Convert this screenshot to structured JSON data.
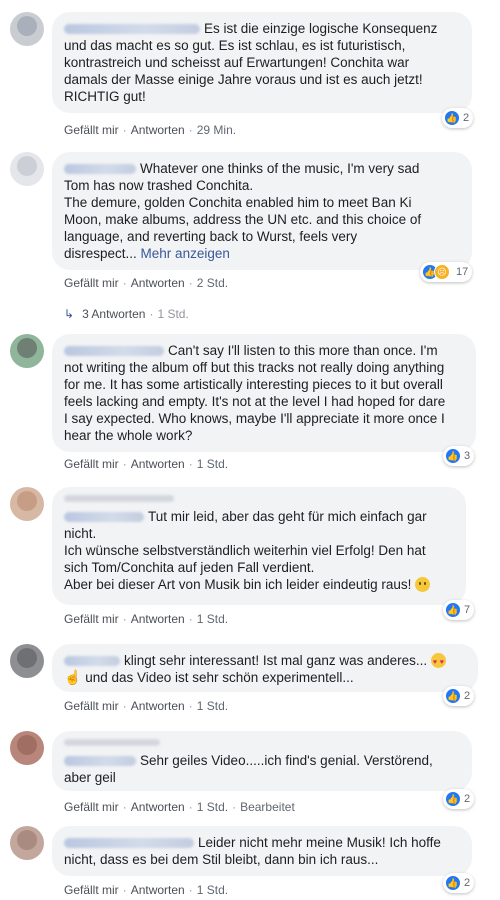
{
  "labels": {
    "like": "Gefällt mir",
    "reply": "Antworten",
    "edited": "Bearbeitet",
    "see_more": "Mehr anzeigen",
    "separator": "·"
  },
  "comments": [
    {
      "text": "Es ist die einzige logische Konsequenz\nund das macht es so gut. Es ist schlau, es ist futuristisch,\nkontrastreich und scheisst auf Erwartungen! Conchita war\ndamals der Masse einige Jahre voraus und ist es auch jetzt!\nRICHTIG gut!",
      "time": "29 Min.",
      "reaction_count": "2"
    },
    {
      "text": "Whatever one thinks of the music, I'm very sad\nTom has now trashed Conchita.\nThe demure, golden Conchita enabled him to meet Ban Ki\nMoon, make albums, address the UN etc. and this choice of\nlanguage, and reverting back to Wurst, feels very\ndisrespect...",
      "time": "2 Std.",
      "reaction_count": "17",
      "replies_label": "3 Antworten",
      "replies_time": "1 Std."
    },
    {
      "text": "Can't say I'll listen to this more than once. I'm\nnot writing the album off but this tracks not really doing anything\nfor me. It has some artistically interesting pieces to it but overall\nfeels lacking and empty. It's not at the level I had hoped for dare\nI say expected. Who knows, maybe I'll appreciate it more once I\nhear the whole work?",
      "time": "1 Std.",
      "reaction_count": "3"
    },
    {
      "text": "Tut mir leid, aber das geht für mich einfach gar\nnicht.\nIch wünsche selbstverständlich weiterhin viel Erfolg! Den hat\nsich Tom/Conchita auf jeden Fall verdient.\nAber bei dieser Art von Musik bin ich leider eindeutig raus!",
      "time": "1 Std.",
      "reaction_count": "7"
    },
    {
      "text": "klingt sehr interessant! Ist mal ganz was anderes...",
      "text2": "und das Video ist sehr schön experimentell...",
      "time": "1 Std.",
      "reaction_count": "2"
    },
    {
      "text": "Sehr geiles Video.....ich find's genial. Verstörend,\naber geil",
      "time": "1 Std.",
      "reaction_count": "2"
    },
    {
      "text": "Leider nicht mehr meine Musik! Ich hoffe\nnicht, dass es bei dem Stil bleibt, dann bin ich raus...",
      "time": "1 Std.",
      "reaction_count": "2"
    }
  ]
}
